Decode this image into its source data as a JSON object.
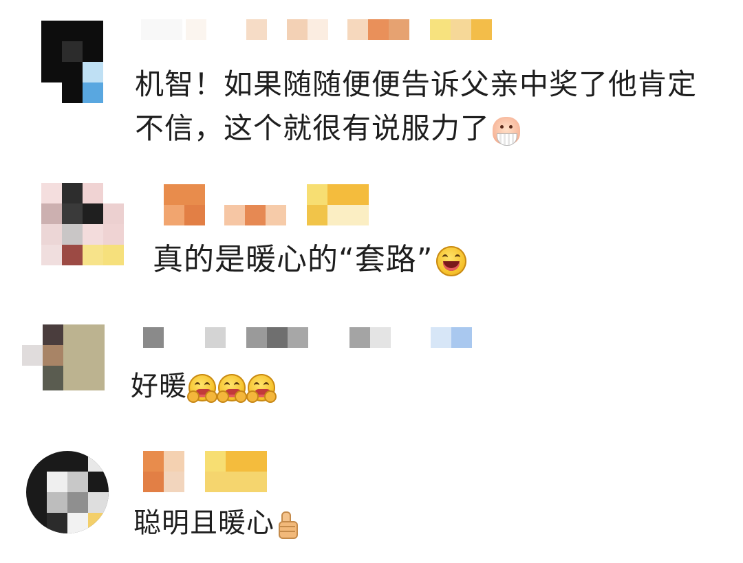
{
  "comments": [
    {
      "text_line1": "机智！如果随随便便告诉父亲中奖了他肯定",
      "text_line2": "不信，这个就很有说服力了",
      "emoji": "fan-face-icon"
    },
    {
      "text": "真的是暖心的“套路”",
      "emoji": "laughing-face-icon"
    },
    {
      "text": "好暖",
      "emoji": "warm-hug-face-icon"
    },
    {
      "text": "聪明且暖心",
      "emoji": "thumbs-up-icon"
    }
  ]
}
